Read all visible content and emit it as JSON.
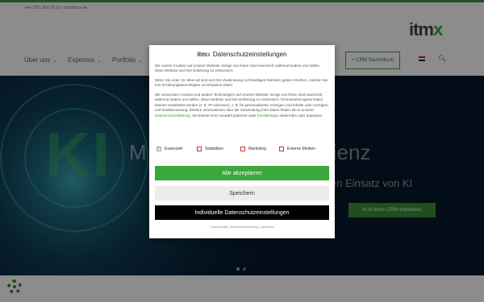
{
  "header": {
    "contact": "+49 7201 968 25 10 | info@itmx.de",
    "logo_main": "itm",
    "logo_x": "x"
  },
  "nav": {
    "items": [
      {
        "label": "Über uns"
      },
      {
        "label": "Expertise"
      },
      {
        "label": "Portfolio"
      }
    ],
    "crm_button": "+ CRM Stammtisch"
  },
  "hero": {
    "ki_text": "KI",
    "title_left": "M",
    "title_right": "Effizienz",
    "subtitle": "en Einsatz von KI",
    "cta": "KI in Ihrem CRM entdecken"
  },
  "modal": {
    "brand": "itm",
    "brand_x": "x",
    "title": "Datenschutzeinstellungen",
    "para1": "Wir nutzen Cookies auf unserer Website. Einige von ihnen sind essenziell, während andere uns helfen, diese Website und Ihre Erfahrung zu verbessern.",
    "para2": "Wenn Sie unter 16 Jahre alt sind und Ihre Zustimmung zu freiwilligen Diensten geben möchten, müssen Sie Ihre Erziehungsberechtigten um Erlaubnis bitten.",
    "para3": "Wir verwenden Cookies und andere Technologien auf unserer Website. Einige von ihnen sind essenziell, während andere uns helfen, diese Website und Ihre Erfahrung zu verbessern. Personenbezogene Daten können verarbeitet werden (z. B. IP-Adressen), z. B. für personalisierte Anzeigen und Inhalte oder Anzeigen- und Inhaltsmessung. Weitere Informationen über die Verwendung Ihrer Daten finden Sie in unserer",
    "privacy_link": "Datenschutzerklärung",
    "para3_mid": ". Sie können Ihre Auswahl jederzeit unter",
    "settings_link": "Einstellungen",
    "para3_end": "widerrufen oder anpassen.",
    "checkboxes": [
      {
        "label": "Essenziell",
        "checked": true
      },
      {
        "label": "Statistiken",
        "checked": false
      },
      {
        "label": "Marketing",
        "checked": false
      },
      {
        "label": "Externe Medien",
        "checked": false
      }
    ],
    "accept_all": "Alle akzeptieren",
    "save": "Speichern",
    "custom": "Individuelle Datenschutzeinstellungen",
    "footer": "Cookie-Details | Datenschutzerklärung | Impressum"
  },
  "colors": {
    "accent": "#3aa83a",
    "dark": "#000000"
  }
}
